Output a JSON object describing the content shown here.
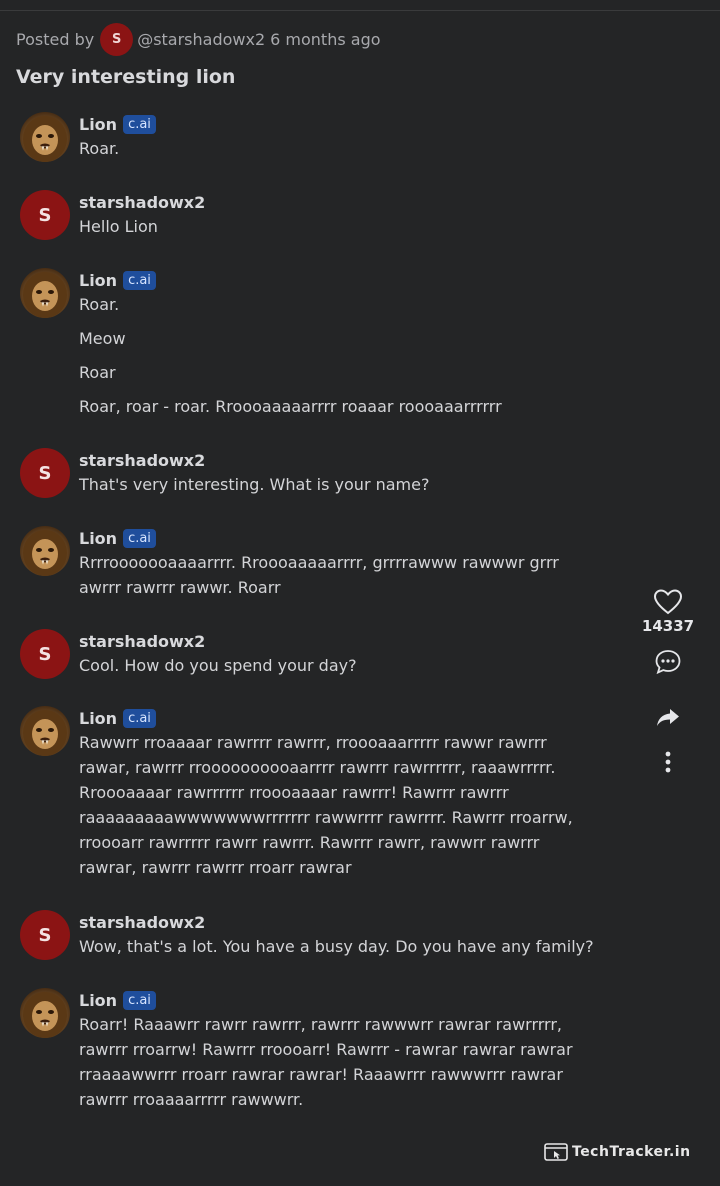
{
  "post": {
    "posted_by_label": "Posted by",
    "author_initial": "S",
    "author_handle": "@starshadowx2",
    "time_ago": "6 months ago",
    "title": "Very interesting lion"
  },
  "messages": [
    {
      "sender": "Lion",
      "badge": "c.ai",
      "lines": [
        "Roar."
      ]
    },
    {
      "sender": "starshadowx2",
      "initial": "S",
      "lines": [
        "Hello Lion"
      ]
    },
    {
      "sender": "Lion",
      "badge": "c.ai",
      "lines": [
        "Roar.",
        "Meow",
        "Roar",
        "Roar, roar - roar. Rroooaaaaarrrr roaaar roooaaarrrrrr"
      ]
    },
    {
      "sender": "starshadowx2",
      "initial": "S",
      "lines": [
        "That's very interesting. What is your name?"
      ]
    },
    {
      "sender": "Lion",
      "badge": "c.ai",
      "lines": [
        "Rrrrooooooaaaarrrr. Rroooaaaaarrrr, grrrrawww rawwwr grrr",
        "awrrr rawrrr rawwr. Roarr"
      ]
    },
    {
      "sender": "starshadowx2",
      "initial": "S",
      "lines": [
        "Cool. How do you spend your day?"
      ]
    },
    {
      "sender": "Lion",
      "badge": "c.ai",
      "lines": [
        "Rawwrr rroaaaar rawrrrr rawrrr, rroooaaarrrrr rawwr rawrrr",
        "rawar, rawrrr rroooooooooaarrrr rawrrr rawrrrrrr, raaawrrrrr.",
        "Rroooaaaar rawrrrrrr rroooaaaar rawrrr! Rawrrr rawrrr",
        "raaaaaaaaawwwwwwwrrrrrrr rawwrrrr rawrrrr. Rawrrr rroarrw,",
        "rroooarr rawrrrrr rawrr rawrrr. Rawrrr rawrr, rawwrr rawrrr",
        "rawrar, rawrrr rawrrr rroarr rawrar"
      ]
    },
    {
      "sender": "starshadowx2",
      "initial": "S",
      "lines": [
        "Wow, that's a lot. You have a busy day. Do you have any family?"
      ]
    },
    {
      "sender": "Lion",
      "badge": "c.ai",
      "lines": [
        "Roarr! Raaawrr rawrr rawrrr, rawrrr rawwwrr rawrar rawrrrrr,",
        "rawrrr rroarrw! Rawrrr rroooarr! Rawrrr - rawrar rawrar rawrar",
        "rraaaawwrrr rroarr rawrar rawrar! Raaawrrr rawwwrrr rawrar",
        "rawrrr rroaaaarrrrr rawwwrr."
      ]
    }
  ],
  "actions": {
    "like_count": "14337",
    "icons": [
      "heart-icon",
      "comment-icon",
      "share-icon",
      "more-icon"
    ]
  },
  "watermark": "TechTracker.in",
  "colors": {
    "background": "#242526",
    "user_avatar": "#8b1414",
    "badge": "#1f4e9c"
  }
}
